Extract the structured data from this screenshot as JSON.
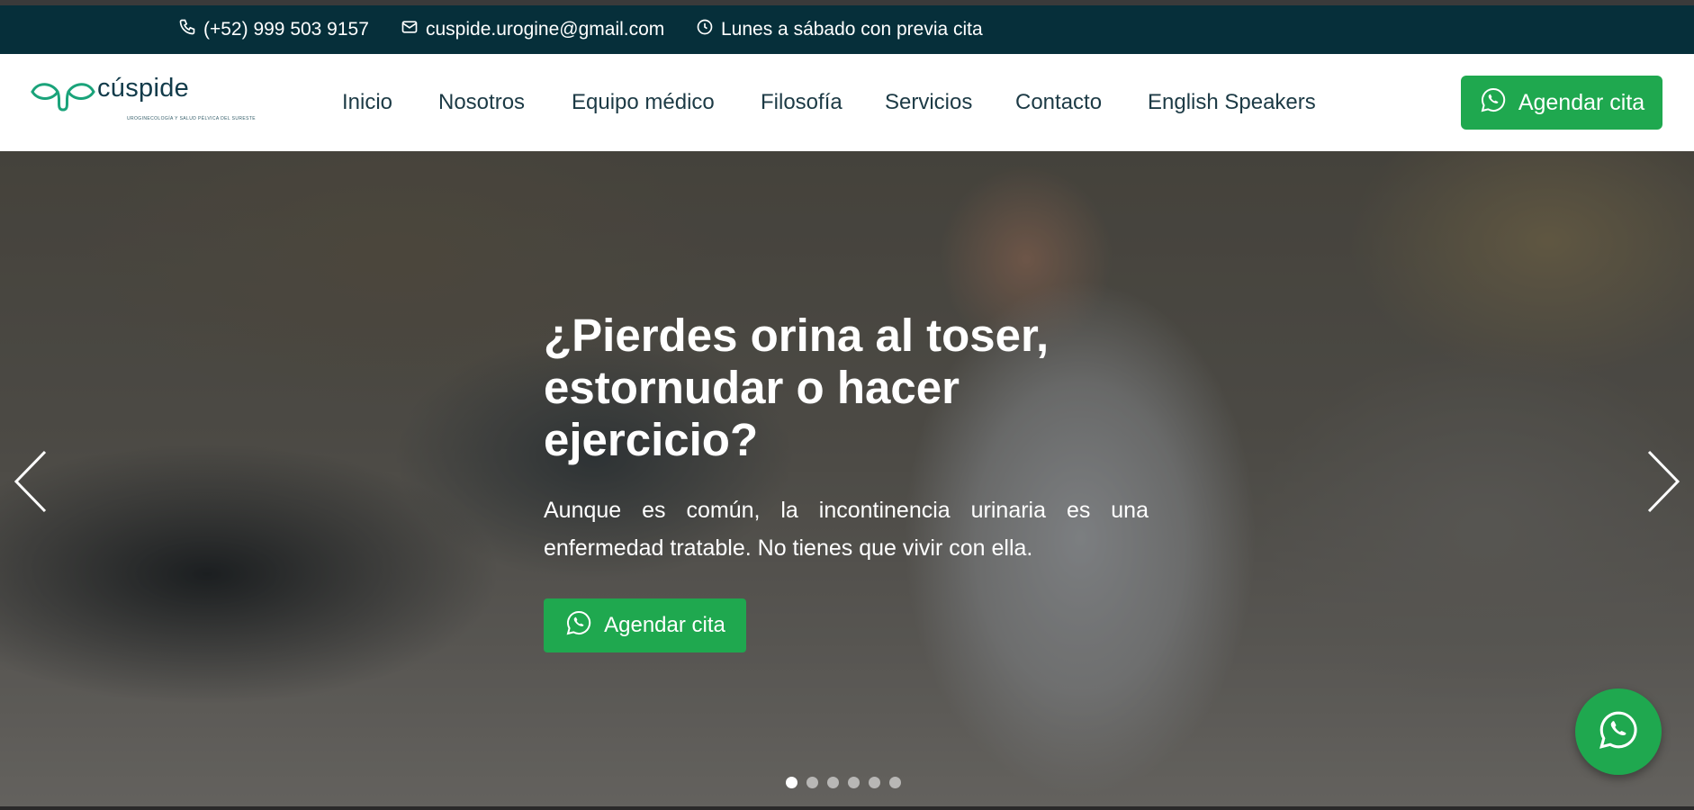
{
  "topbar": {
    "phone": "(+52) 999 503 9157",
    "email": "cuspide.urogine@gmail.com",
    "hours": "Lunes a sábado con previa cita",
    "icons": [
      "phone-icon",
      "mail-icon",
      "clock-icon"
    ]
  },
  "logo": {
    "brand": "cúspide",
    "tagline": "UROGINECOLOGÍA Y SALUD PÉLVICA DEL SURESTE"
  },
  "nav": {
    "links": [
      "Inicio",
      "Nosotros",
      "Equipo médico",
      "Filosofía",
      "Servicios",
      "Contacto",
      "English Speakers"
    ],
    "cta_label": "Agendar cita"
  },
  "hero": {
    "title": "¿Pierdes orina al toser, estornudar o hacer ejercicio?",
    "subtitle": "Aunque es común, la incontinencia urinaria es una enfermedad tratable. No tienes que vivir con ella.",
    "cta_label": "Agendar cita",
    "active_slide": 1,
    "slide_count": 6
  },
  "colors": {
    "topbar_bg": "#062f3a",
    "accent_green": "#1fa84f",
    "nav_text": "#1c3a45"
  }
}
